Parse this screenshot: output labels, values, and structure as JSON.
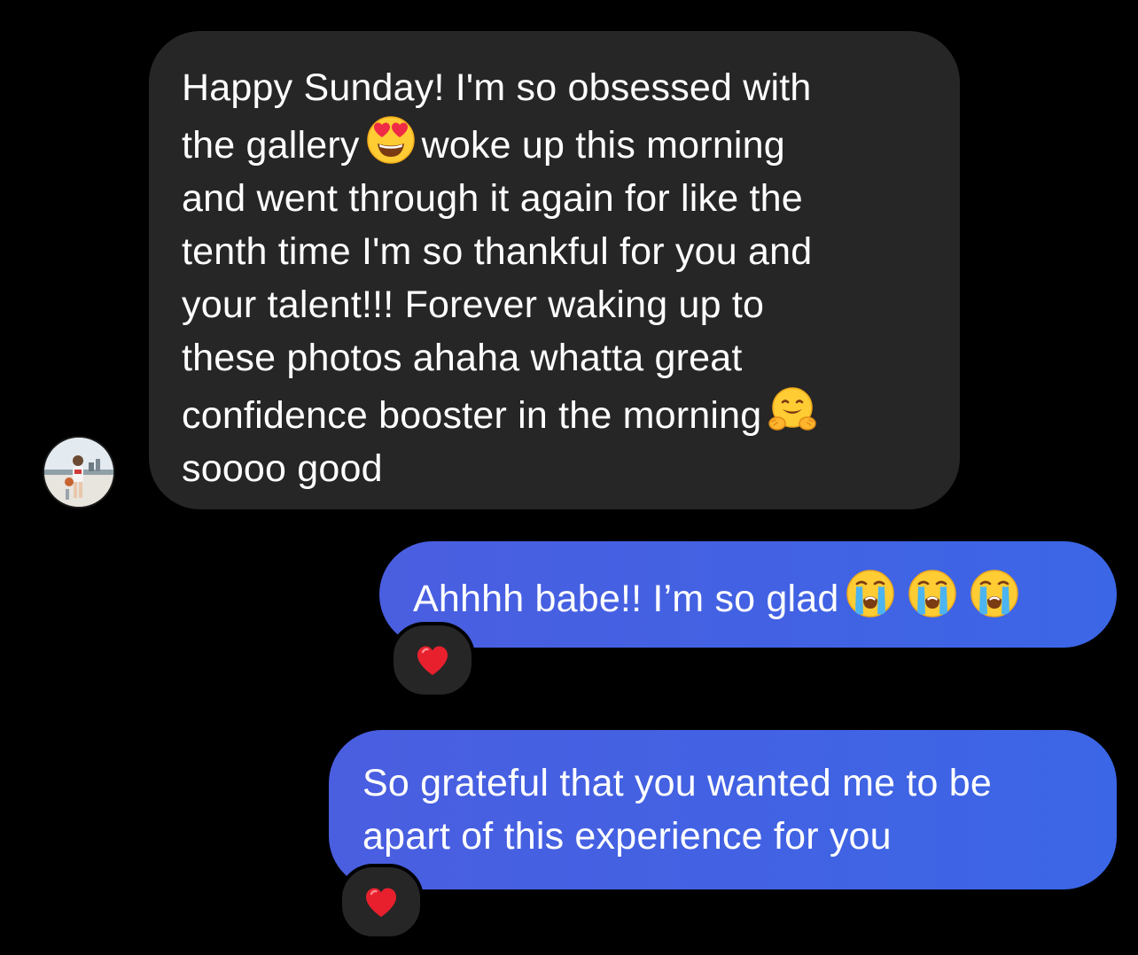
{
  "conversation": {
    "incoming": {
      "lines": [
        {
          "segments": [
            {
              "text": "Happy Sunday! I'm so obsessed with"
            }
          ]
        },
        {
          "segments": [
            {
              "text": "the gallery"
            },
            {
              "emoji": "heart-eyes"
            },
            {
              "text": "woke up this morning"
            }
          ]
        },
        {
          "segments": [
            {
              "text": "and went through it again for like the"
            }
          ]
        },
        {
          "segments": [
            {
              "text": "tenth time I'm so thankful for you and"
            }
          ]
        },
        {
          "segments": [
            {
              "text": "your talent!!! Forever waking up to"
            }
          ]
        },
        {
          "segments": [
            {
              "text": "these photos ahaha whatta great"
            }
          ]
        },
        {
          "segments": [
            {
              "text": "confidence booster in the morning"
            },
            {
              "emoji": "hugging"
            }
          ]
        },
        {
          "segments": [
            {
              "text": "soooo good"
            }
          ]
        }
      ]
    },
    "outgoing": [
      {
        "lines": [
          {
            "segments": [
              {
                "text": "Ahhhh babe!! I’m so glad"
              },
              {
                "emoji": "crying"
              },
              {
                "emoji": "crying"
              },
              {
                "emoji": "crying"
              }
            ]
          }
        ],
        "reaction": "red-heart"
      },
      {
        "lines": [
          {
            "segments": [
              {
                "text": "So grateful that you wanted me to be"
              }
            ]
          },
          {
            "segments": [
              {
                "text": "apart of this experience for you"
              }
            ]
          }
        ],
        "reaction": "red-heart"
      }
    ]
  },
  "colors": {
    "background": "#000000",
    "incoming_bubble": "#262626",
    "outgoing_bubble": "#4a5ee0",
    "text": "#ffffff",
    "reaction_heart": "#e8202e"
  },
  "icons": {
    "avatar": "contact-avatar-photo",
    "heart_eyes": "heart-eyes-emoji",
    "hugging": "hugging-face-emoji",
    "crying": "loudly-crying-face-emoji",
    "reaction": "red-heart-reaction-icon"
  }
}
